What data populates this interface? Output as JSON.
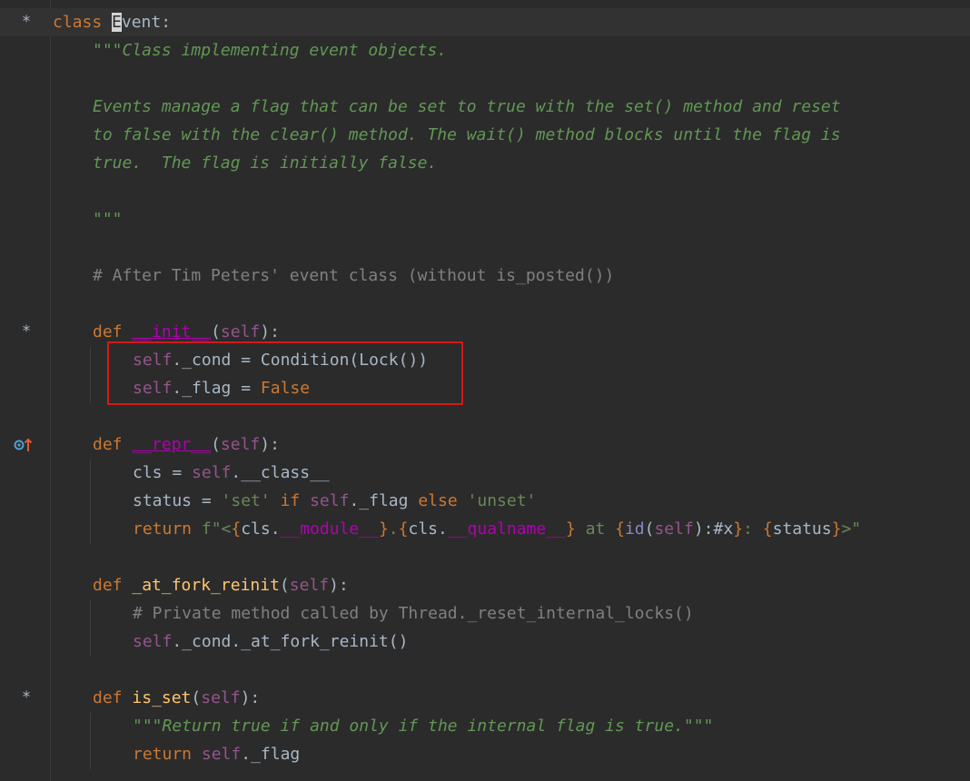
{
  "editor": {
    "language": "python",
    "colors": {
      "background": "#2b2b2b",
      "keyword": "#cc7832",
      "self": "#94558d",
      "magic": "#b200b2",
      "function": "#ffc66d",
      "string": "#6a8759",
      "docstring": "#629755",
      "comment": "#808080",
      "highlight_box": "#d21a1a"
    },
    "gutter": {
      "star": "*",
      "override_icon": "override-up-arrow-icon"
    },
    "l1": {
      "kw": "class",
      "name_first": "E",
      "name_rest": "vent",
      "colon": ":"
    },
    "l2": {
      "doc": "\"\"\"Class implementing event objects."
    },
    "l4": {
      "doc": "Events manage a flag that can be set to true with the set() method and reset"
    },
    "l5": {
      "doc": "to false with the clear() method. The wait() method blocks until the flag is"
    },
    "l6": {
      "doc": "true.  The flag is initially false."
    },
    "l8": {
      "doc": "\"\"\""
    },
    "l10": {
      "comment": "# After Tim Peters' event class (without is_posted())"
    },
    "l12": {
      "kw": "def",
      "name": "__init__",
      "p_open": "(",
      "self": "self",
      "p_close": "):"
    },
    "l13": {
      "self": "self",
      "attr": "._cond = Condition(Lock())"
    },
    "l14": {
      "self": "self",
      "attr": "._flag = ",
      "val": "False"
    },
    "l16": {
      "kw": "def",
      "name": "__repr__",
      "p_open": "(",
      "self": "self",
      "p_close": "):"
    },
    "l17": {
      "a": "cls = ",
      "self": "self",
      "b": ".",
      "c": "__class__"
    },
    "l18": {
      "a": "status = ",
      "s1": "'set'",
      "if": " if ",
      "self": "self",
      "b": "._flag",
      "else": " else ",
      "s2": "'unset'"
    },
    "l19": {
      "ret": "return ",
      "f": "f\"<",
      "br1": "{",
      "cls1": "cls.",
      "mod": "__module__",
      "br2": "}",
      "dot": ".",
      "br3": "{",
      "cls2": "cls.",
      "qual": "__qualname__",
      "br4": "}",
      "at": " at ",
      "br5": "{",
      "idf": "id",
      "po": "(",
      "self": "self",
      "fmt": "):#x",
      "br6": "}",
      "colon": ": ",
      "br7": "{",
      "status": "status",
      "br8": "}",
      "end": ">\""
    },
    "l21": {
      "kw": "def",
      "name": "_at_fork_reinit",
      "p_open": "(",
      "self": "self",
      "p_close": "):"
    },
    "l22": {
      "comment": "# Private method called by Thread._reset_internal_locks()"
    },
    "l23": {
      "self": "self",
      "rest": "._cond._at_fork_reinit()"
    },
    "l25": {
      "kw": "def",
      "name": "is_set",
      "p_open": "(",
      "self": "self",
      "p_close": "):"
    },
    "l26": {
      "doc": "\"\"\"Return true if and only if the internal flag is true.\"\"\""
    },
    "l27": {
      "ret": "return ",
      "self": "self",
      "rest": "._flag"
    }
  }
}
